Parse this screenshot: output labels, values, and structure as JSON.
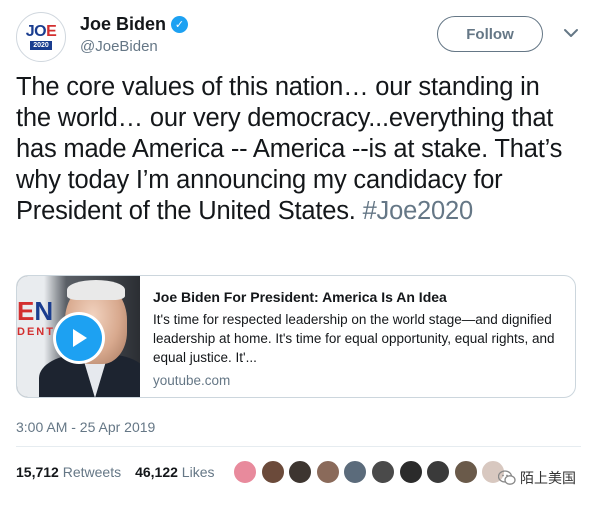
{
  "author": {
    "display_name": "Joe Biden",
    "handle": "@JoeBiden",
    "verified": true,
    "avatar_logo_top": "JOE",
    "avatar_logo_bottom": "2020"
  },
  "actions": {
    "follow_label": "Follow"
  },
  "tweet": {
    "text": "The core values of this nation… our standing in the world… our very democracy...everything that has made America -- America --is at stake. That’s why today I’m announcing my candidacy for President of the United States. ",
    "hashtag": "#Joe2020"
  },
  "card": {
    "thumbnail_logo_top": "EN",
    "thumbnail_logo_bottom": "DENT",
    "title": "Joe Biden For President: America Is An Idea",
    "description": "It's time for respected leadership on the world stage—and dignified leadership at home. It's time for equal opportunity, equal rights, and equal justice. It'...",
    "domain": "youtube.com"
  },
  "timestamp": "3:00 AM - 25 Apr 2019",
  "stats": {
    "retweets_count": "15,712",
    "retweets_label": "Retweets",
    "likes_count": "46,122",
    "likes_label": "Likes"
  },
  "likers_colors": [
    "#e88a9c",
    "#6b4a3a",
    "#3d3530",
    "#8a6a5a",
    "#5b6b7b",
    "#4a4a4a",
    "#2b2b2b",
    "#3a3a3a",
    "#6a5a4a",
    "#d8c8c0"
  ],
  "watermark": {
    "text": "陌上美国"
  },
  "colors": {
    "accent": "#1da1f2",
    "text_primary": "#14171a",
    "text_secondary": "#657786"
  }
}
